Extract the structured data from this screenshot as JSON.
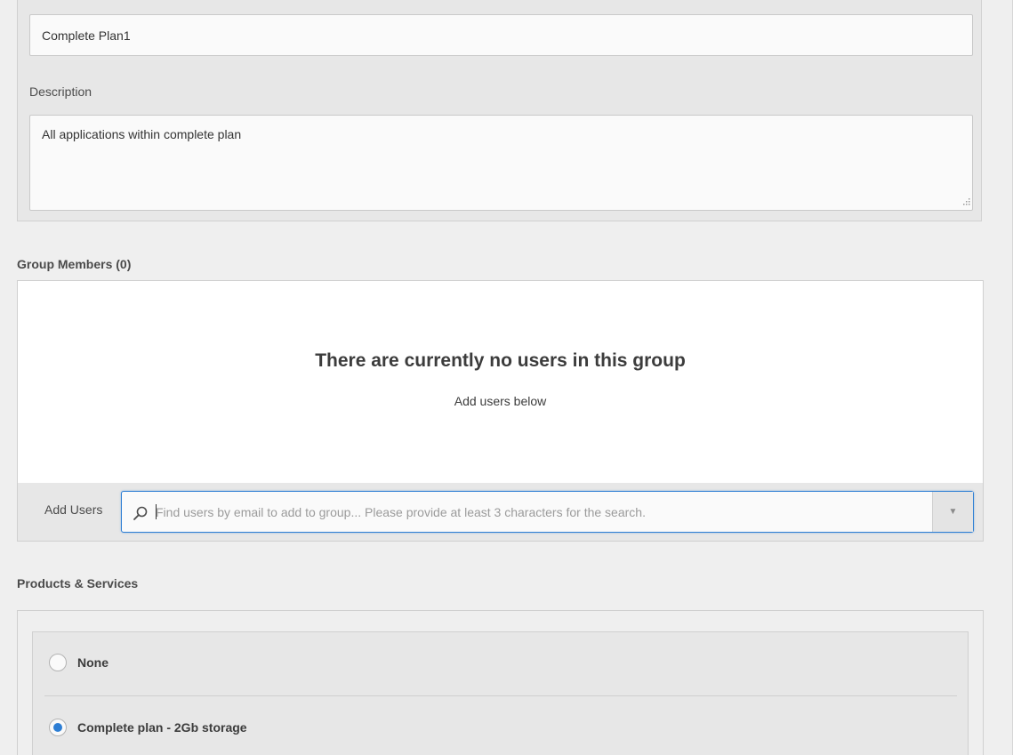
{
  "group_details": {
    "name_value": "Complete Plan1",
    "description_label": "Description",
    "description_value": "All applications within complete plan"
  },
  "group_members": {
    "title": "Group Members (0)",
    "empty_heading": "There are currently no users in this group",
    "empty_subtext": "Add users below",
    "add_users_label": "Add Users",
    "search_placeholder": "Find users by email to add to group... Please provide at least 3 characters for the search.",
    "search_value": "",
    "search_icon": "search-icon",
    "dropdown_icon": "caret-down-icon",
    "dropdown_glyph": "▼"
  },
  "products_services": {
    "title": "Products & Services",
    "options": [
      {
        "label": "None",
        "selected": false
      },
      {
        "label": "Complete plan - 2Gb storage",
        "selected": true
      }
    ]
  },
  "colors": {
    "accent": "#2d7ed4",
    "panel_bg": "#e7e7e7",
    "page_bg": "#efefef"
  }
}
